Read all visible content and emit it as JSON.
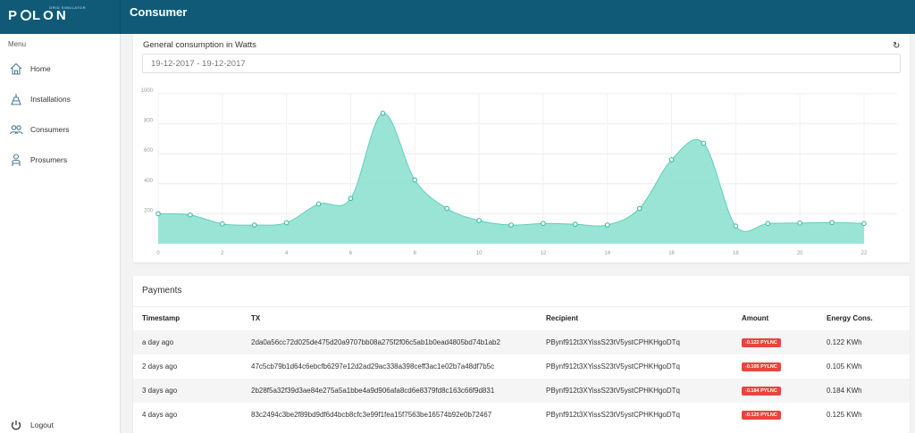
{
  "brand": {
    "logo_left": "P",
    "logo_right": "LON",
    "tagline": "GRID SIMULATOR"
  },
  "header": {
    "title": "Consumer"
  },
  "sidebar": {
    "menu_label": "Menu",
    "items": [
      {
        "label": "Home",
        "icon": "home-icon"
      },
      {
        "label": "Installations",
        "icon": "installation-icon"
      },
      {
        "label": "Consumers",
        "icon": "users-icon"
      },
      {
        "label": "Prosumers",
        "icon": "prosumer-icon"
      }
    ],
    "logout_label": "Logout"
  },
  "consumption": {
    "title": "General consumption in Watts",
    "date_range": "19-12-2017 - 19-12-2017",
    "refresh_icon": "refresh-icon",
    "chart_data": {
      "type": "area",
      "x": [
        0,
        1,
        2,
        3,
        4,
        5,
        6,
        7,
        8,
        9,
        10,
        11,
        12,
        13,
        14,
        15,
        16,
        17,
        18,
        19,
        20,
        21,
        22
      ],
      "values": [
        200,
        192,
        132,
        125,
        140,
        265,
        302,
        870,
        425,
        235,
        155,
        125,
        135,
        130,
        125,
        235,
        560,
        670,
        118,
        135,
        138,
        142,
        135
      ],
      "ylim": [
        0,
        1000
      ],
      "yticks": [
        "1000",
        "800",
        "600",
        "400",
        "200"
      ],
      "xticks": [
        "0",
        "2",
        "4",
        "6",
        "8",
        "10",
        "12",
        "14",
        "16",
        "18",
        "20",
        "22"
      ],
      "color": "#8fe1d1",
      "grid": true
    }
  },
  "payments": {
    "title": "Payments",
    "columns": [
      "Timestamp",
      "TX",
      "Recipient",
      "Amount",
      "Energy Cons."
    ],
    "rows": [
      {
        "timestamp": "a day ago",
        "tx": "2da0a56cc72d025de475d20a9707bb08a275f2f06c5ab1b0ead4805bd74b1ab2",
        "recipient": "PBynf912t3XYissS23tV5ystCPHKHgoDTq",
        "amount": "-0.122 PYLNC",
        "energy": "0.122 KWh"
      },
      {
        "timestamp": "2 days ago",
        "tx": "47c5cb79b1d64c6ebcfb6297e12d2ad29ac338a398ceff3ac1e02b7a48df7b5c",
        "recipient": "PBynf912t3XYissS23tV5ystCPHKHgoDTq",
        "amount": "-0.105 PYLNC",
        "energy": "0.105 KWh"
      },
      {
        "timestamp": "3 days ago",
        "tx": "2b28f5a32f39d3ae84e275a5a1bbe4a9d906afa8cd6e8379fd8c163c66f9d831",
        "recipient": "PBynf912t3XYissS23tV5ystCPHKHgoDTq",
        "amount": "-0.184 PYLNC",
        "energy": "0.184 KWh"
      },
      {
        "timestamp": "4 days ago",
        "tx": "83c2494c3be2f89bd9df6d4bcb8cfc3e99f1fea15f7563be16574b92e0b72467",
        "recipient": "PBynf912t3XYissS23tV5ystCPHKHgoDTq",
        "amount": "-0.125 PYLNC",
        "energy": "0.125 KWh"
      }
    ]
  }
}
